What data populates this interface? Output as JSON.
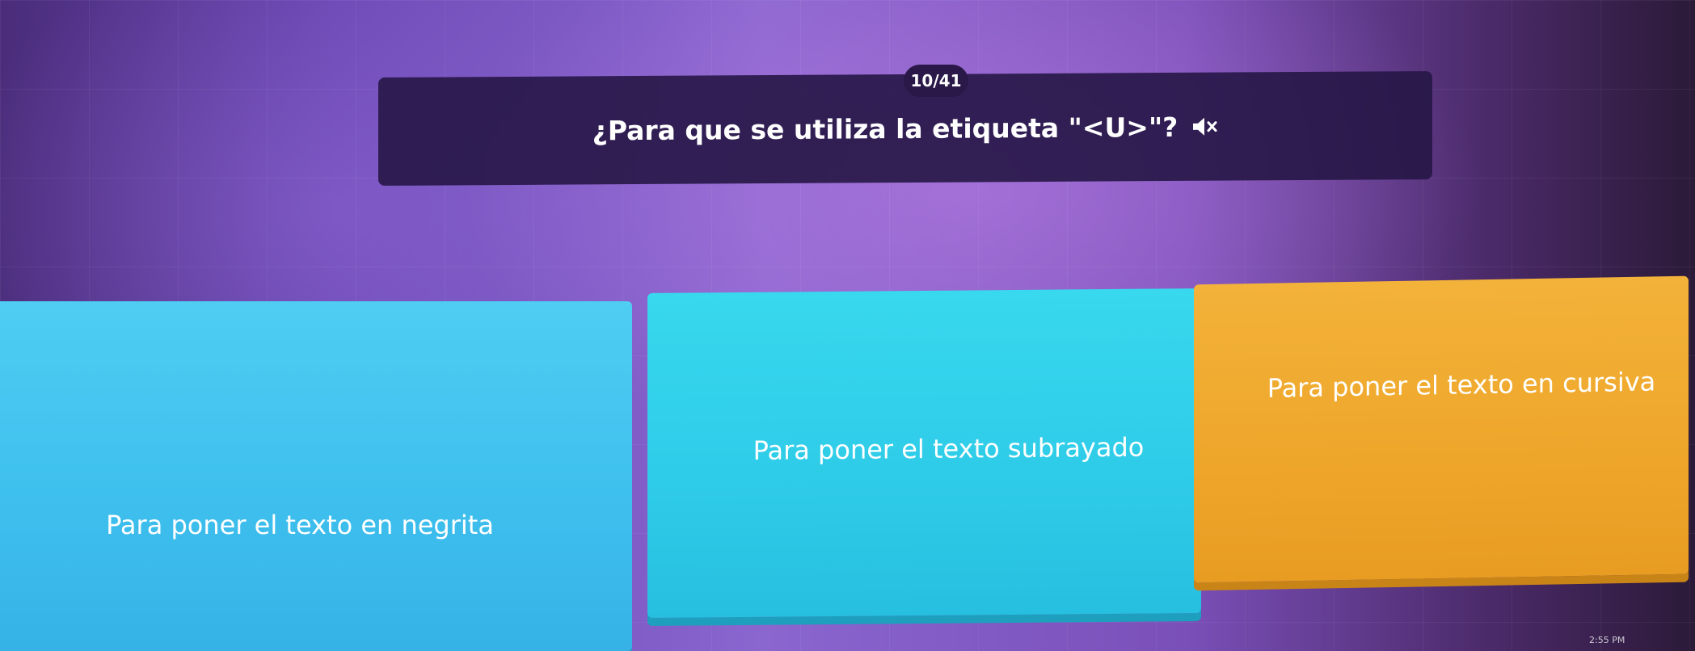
{
  "progress": {
    "counter": "10/41"
  },
  "question": {
    "text": "¿Para que se utiliza la etiqueta \"<U>\"?",
    "audio_icon": "speaker-mute-icon"
  },
  "options": [
    {
      "label": "Para poner el texto en negrita",
      "color": "#3ec0ee"
    },
    {
      "label": "Para poner el texto subrayado",
      "color": "#2ecbe8"
    },
    {
      "label": "Para poner el texto en cursiva",
      "color": "#eea62a"
    }
  ],
  "system": {
    "clock": "2:55 PM"
  },
  "theme": {
    "background": "#7a55c4",
    "question_bg": "#261646"
  }
}
